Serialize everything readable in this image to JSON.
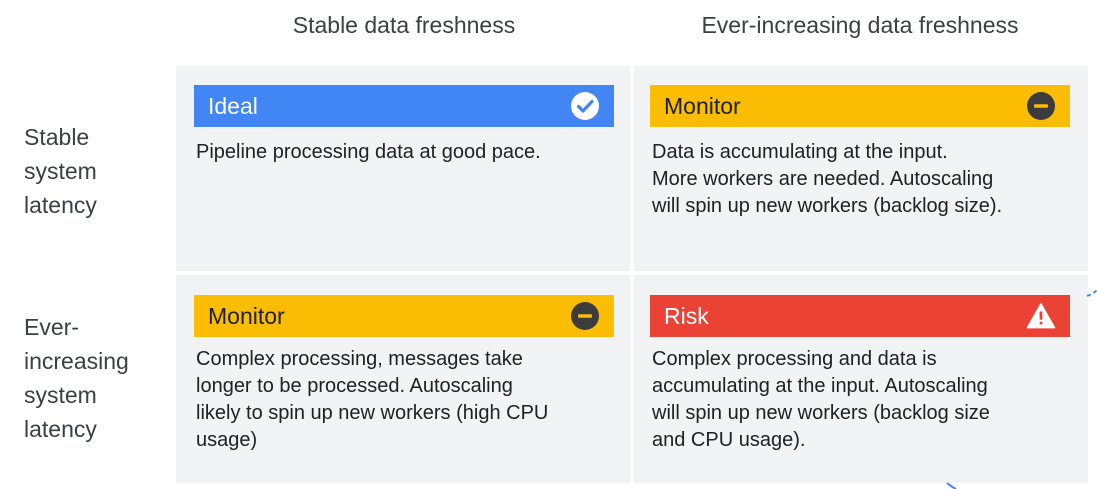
{
  "columns": [
    {
      "label": "Stable data freshness"
    },
    {
      "label": "Ever-increasing data freshness"
    }
  ],
  "rows": [
    {
      "label_lines": [
        "Stable",
        "system",
        "latency"
      ]
    },
    {
      "label_lines": [
        "Ever-",
        "increasing",
        "system",
        "latency"
      ]
    }
  ],
  "cells": [
    {
      "status": "Ideal",
      "icon": "check-circle-icon",
      "color": "#4285f4",
      "lines": [
        "Pipeline processing data at good pace."
      ]
    },
    {
      "status": "Monitor",
      "icon": "minus-circle-icon",
      "color": "#fbbc04",
      "lines": [
        "Data is accumulating at the input.",
        "More workers are needed. Autoscaling",
        "will spin up new workers (backlog size)."
      ]
    },
    {
      "status": "Monitor",
      "icon": "minus-circle-icon",
      "color": "#fbbc04",
      "lines": [
        "Complex processing, messages take",
        "longer to be processed. Autoscaling",
        "likely to spin up new workers (high CPU",
        "usage)"
      ]
    },
    {
      "status": "Risk",
      "icon": "warning-triangle-icon",
      "color": "#ea4335",
      "lines": [
        "Complex processing and data is",
        "accumulating at the input. Autoscaling",
        "will spin up new workers (backlog size",
        "and CPU usage)."
      ]
    }
  ],
  "colors": {
    "cell_background": "#f1f3f4",
    "decorative_arc": "#4285f4"
  }
}
